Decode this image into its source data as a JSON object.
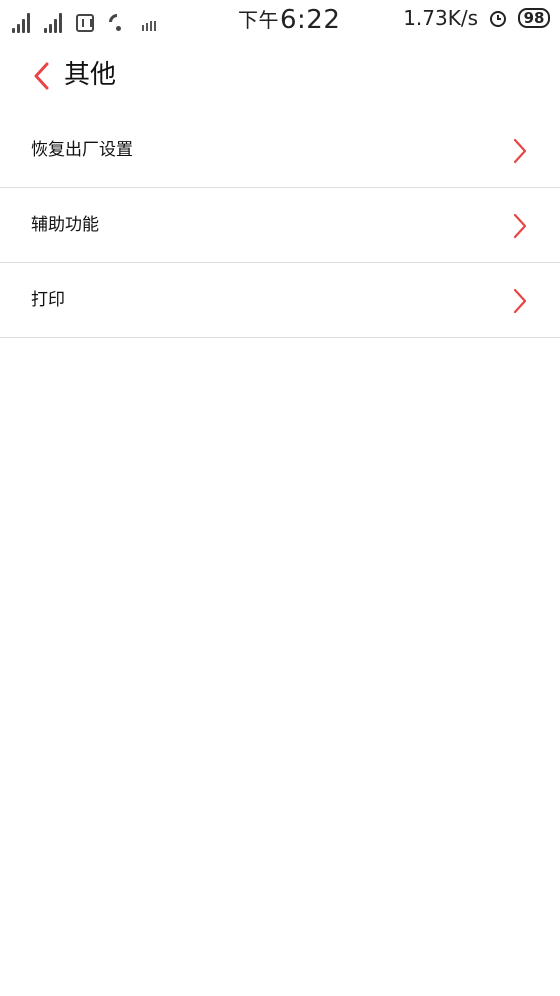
{
  "status_bar": {
    "time_ampm": "下午",
    "time": "6:22",
    "network_speed": "1.73K/s",
    "battery_level": "98",
    "icons": [
      "signal-icon",
      "signal-icon",
      "hd-icon",
      "wifi-icon",
      "data-activity-icon",
      "alarm-icon",
      "battery-icon"
    ]
  },
  "header": {
    "title": "其他",
    "back_icon": "chevron-left-icon"
  },
  "settings": {
    "items": [
      {
        "label": "恢复出厂设置",
        "icon": "chevron-right-icon"
      },
      {
        "label": "辅助功能",
        "icon": "chevron-right-icon"
      },
      {
        "label": "打印",
        "icon": "chevron-right-icon"
      }
    ]
  },
  "colors": {
    "accent": "#e84545",
    "text": "#111111",
    "divider": "#dedede",
    "background": "#ffffff"
  }
}
